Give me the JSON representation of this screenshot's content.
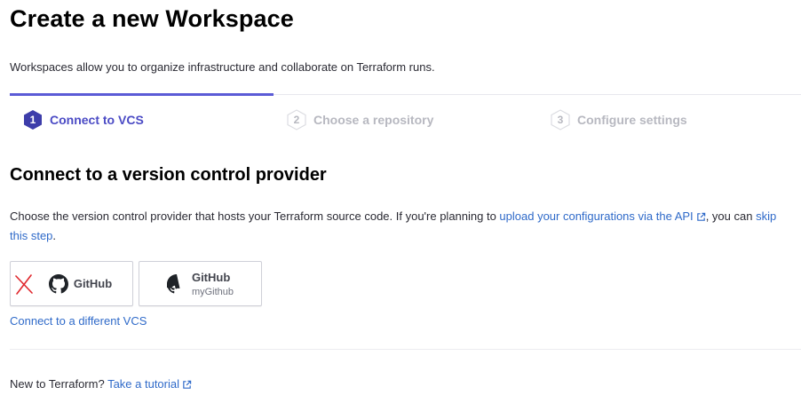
{
  "page": {
    "title": "Create a new Workspace",
    "subtitle": "Workspaces allow you to organize infrastructure and collaborate on Terraform runs."
  },
  "steps": [
    {
      "number": "1",
      "label": "Connect to VCS",
      "state": "active"
    },
    {
      "number": "2",
      "label": "Choose a repository",
      "state": "inactive"
    },
    {
      "number": "3",
      "label": "Configure settings",
      "state": "inactive"
    }
  ],
  "section": {
    "heading": "Connect to a version control provider",
    "description_prefix": "Choose the version control provider that hosts your Terraform source code. If you're planning to ",
    "api_link": "upload your configurations via the API",
    "description_mid": ", you can ",
    "skip_link": "skip this step",
    "description_suffix": "."
  },
  "providers": [
    {
      "name": "GitHub",
      "sub": "",
      "icon": "github-icon",
      "marked": "x-mark"
    },
    {
      "name": "GitHub",
      "sub": "myGithub",
      "icon": "github-icon"
    }
  ],
  "different_vcs_link": "Connect to a different VCS",
  "footer": {
    "text": "New to Terraform? ",
    "link": "Take a tutorial"
  },
  "colors": {
    "accent": "#5b5bd6",
    "link": "#2f6ac9",
    "inactive": "#b7b8c0",
    "x_mark": "#e0262c"
  }
}
